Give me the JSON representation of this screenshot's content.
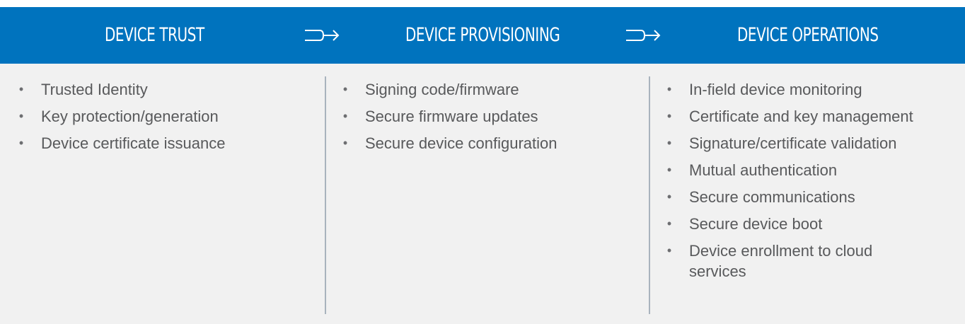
{
  "stages": [
    {
      "title": "DEVICE TRUST",
      "items": [
        "Trusted Identity",
        "Key protection/generation",
        "Device certificate issuance"
      ]
    },
    {
      "title": "DEVICE PROVISIONING",
      "items": [
        "Signing code/firmware",
        "Secure firmware updates",
        "Secure device configuration"
      ]
    },
    {
      "title": "DEVICE OPERATIONS",
      "items": [
        "In-field device monitoring",
        "Certificate and key management",
        "Signature/certificate validation",
        "Mutual authentication",
        "Secure communications",
        "Secure device boot",
        "Device enrollment to cloud services"
      ]
    }
  ],
  "bullet_glyph": "•",
  "icons": {
    "flow_arrow": "flow-arrow-icon"
  },
  "colors": {
    "header_bg": "#0073be",
    "header_text": "#ffffff",
    "panel_bg": "#f1f1f1",
    "divider": "#a9b3bd",
    "body_text": "#58595b"
  }
}
